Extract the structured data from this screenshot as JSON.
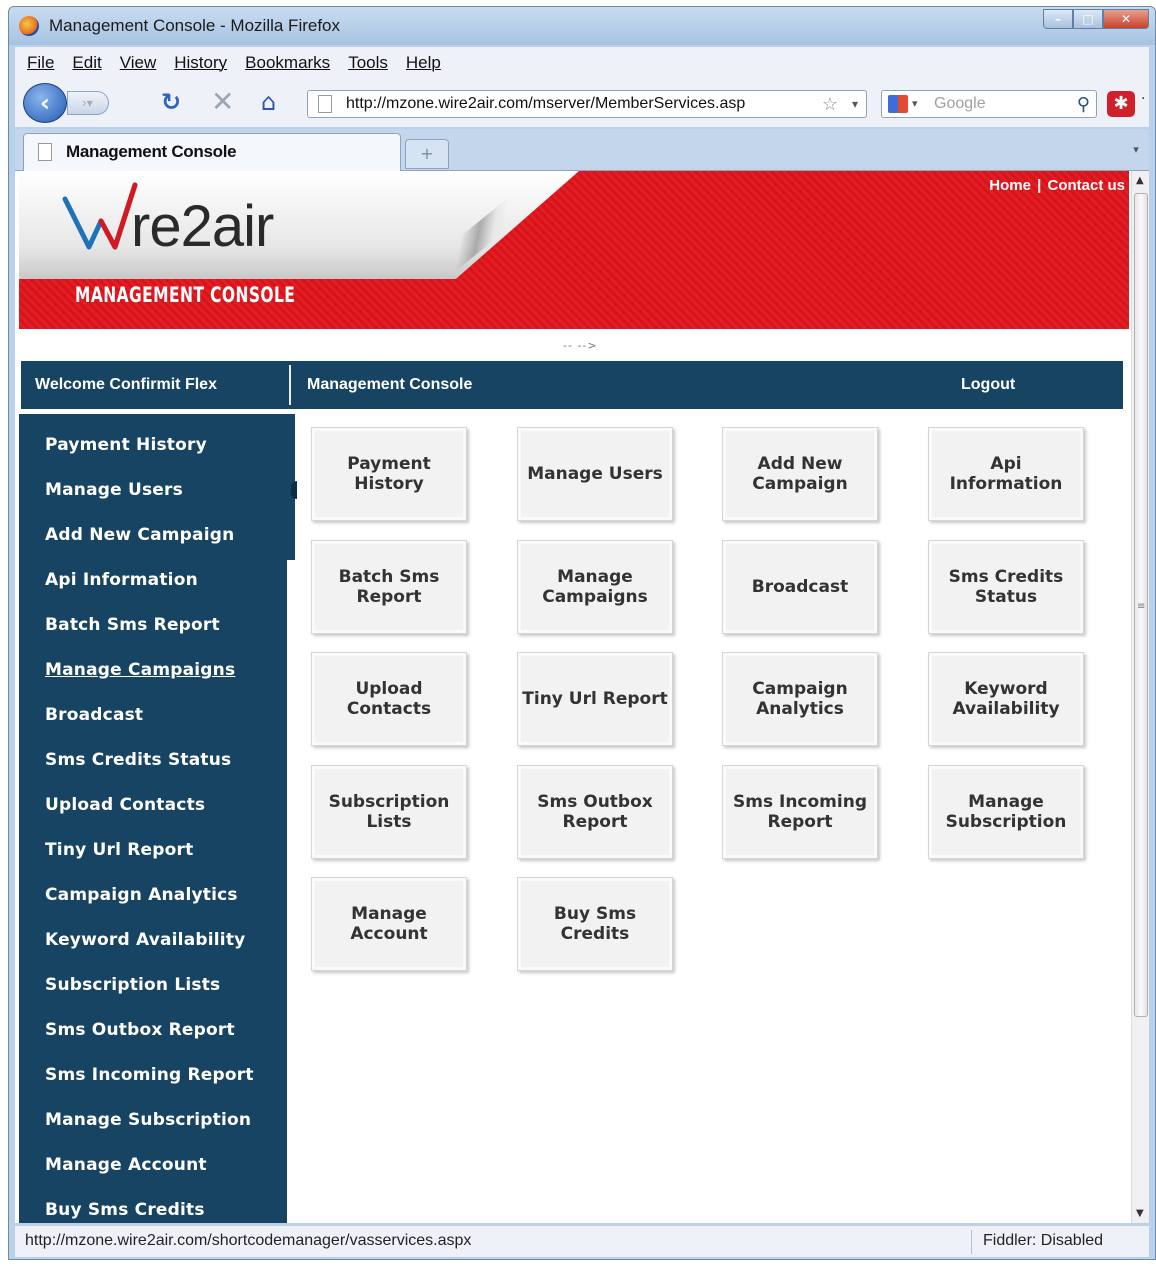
{
  "window": {
    "title": "Management Console - Mozilla Firefox",
    "min": "–",
    "max": "□",
    "close": "✕"
  },
  "menu": [
    "File",
    "Edit",
    "View",
    "History",
    "Bookmarks",
    "Tools",
    "Help"
  ],
  "nav": {
    "url": "http://mzone.wire2air.com/mserver/MemberServices.asp",
    "search_placeholder": "Google"
  },
  "tab": {
    "label": "Management Console",
    "new_tab": "+"
  },
  "site": {
    "logo_text": "re2air",
    "subtitle": "MANAGEMENT CONSOLE",
    "home_link": "Home",
    "contact_link": "Contact us",
    "link_sep": "|",
    "comment": "-- -->"
  },
  "bluebar": {
    "welcome": "Welcome Confirmit Flex",
    "console": "Management Console",
    "logout": "Logout"
  },
  "sidebar": [
    "Payment History",
    "Manage Users",
    "Add New Campaign",
    "Api Information",
    "Batch Sms Report",
    "Manage Campaigns",
    "Broadcast",
    "Sms Credits Status",
    "Upload Contacts",
    "Tiny Url Report",
    "Campaign Analytics",
    "Keyword Availability",
    "Subscription Lists",
    "Sms Outbox Report",
    "Sms Incoming Report",
    "Manage Subscription",
    "Manage Account",
    "Buy Sms Credits"
  ],
  "tiles": [
    "Payment\nHistory",
    "Manage Users",
    "Add New\nCampaign",
    "Api\nInformation",
    "Batch Sms\nReport",
    "Manage\nCampaigns",
    "Broadcast",
    "Sms Credits\nStatus",
    "Upload\nContacts",
    "Tiny Url Report",
    "Campaign\nAnalytics",
    "Keyword\nAvailability",
    "Subscription\nLists",
    "Sms Outbox\nReport",
    "Sms Incoming\nReport",
    "Manage\nSubscription",
    "Manage\nAccount",
    "Buy Sms\nCredits"
  ],
  "status": {
    "url": "http://mzone.wire2air.com/shortcodemanager/vasservices.aspx",
    "fiddler": "Fiddler: Disabled"
  },
  "colors": {
    "nav_blue": "#174462",
    "header_red": "#e21d24"
  }
}
